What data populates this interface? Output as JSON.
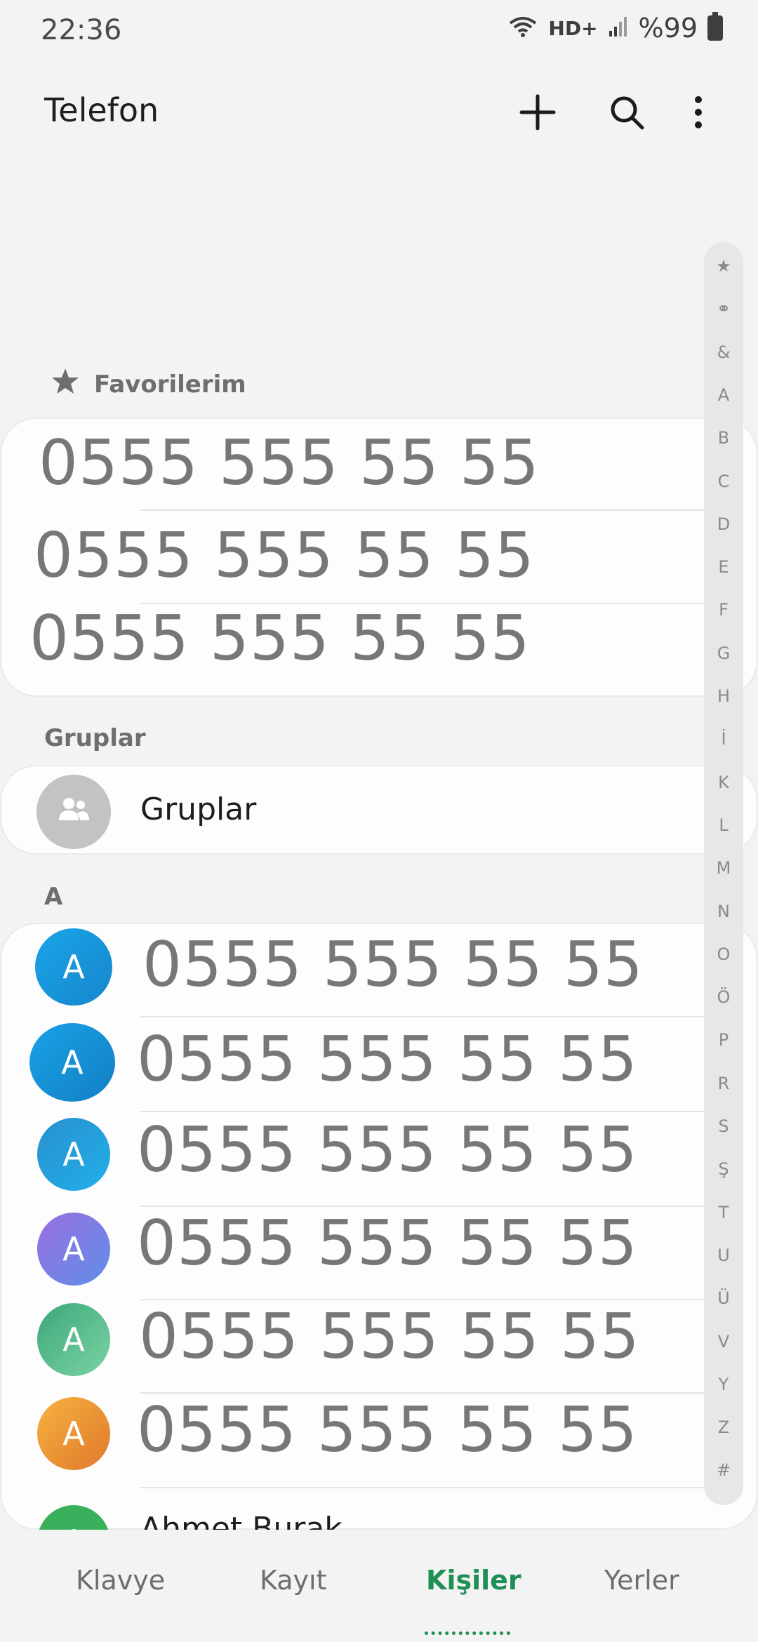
{
  "status_bar": {
    "time": "22:36",
    "network": "HD+",
    "battery": "%99",
    "icons": [
      "wifi-icon",
      "signal-icon",
      "battery-icon"
    ]
  },
  "app_bar": {
    "title": "Telefon",
    "icons": [
      "plus-icon",
      "search-icon",
      "more-vert-icon"
    ]
  },
  "favorites": {
    "header": "Favorilerim",
    "numbers": [
      "0555 555 55 55",
      "0555 555 55 55",
      "0555 555 55 55"
    ]
  },
  "groups": {
    "header": "Gruplar",
    "item_label": "Gruplar"
  },
  "section_a": {
    "header": "A",
    "contacts": [
      {
        "initial": "A",
        "number": "0555 555 55 55",
        "color": "#1d9bdf"
      },
      {
        "initial": "A",
        "number": "0555 555 55 55",
        "color": "#1a98dd"
      },
      {
        "initial": "A",
        "number": "0555 555 55 55",
        "color": "#2a9fdc"
      },
      {
        "initial": "A",
        "number": "0555 555 55 55",
        "color": "#8877e0"
      },
      {
        "initial": "A",
        "number": "0555 555 55 55",
        "color": "#5fbf8c"
      },
      {
        "initial": "A",
        "number": "0555 555 55 55",
        "color": "#f0a03a"
      }
    ],
    "partial_contact": {
      "initial": "A",
      "name": "Ahmet Burak",
      "color": "#3ab05c"
    }
  },
  "index_bar": [
    "★",
    "⚭",
    "&",
    "A",
    "B",
    "C",
    "D",
    "E",
    "F",
    "G",
    "H",
    "İ",
    "K",
    "L",
    "M",
    "N",
    "O",
    "Ö",
    "P",
    "R",
    "S",
    "Ş",
    "T",
    "U",
    "Ü",
    "V",
    "Y",
    "Z",
    "#"
  ],
  "bottom_nav": {
    "tabs": [
      "Klavye",
      "Kayıt",
      "Kişiler",
      "Yerler"
    ],
    "active": "Kişiler"
  },
  "accent_color": "#1f8f55"
}
